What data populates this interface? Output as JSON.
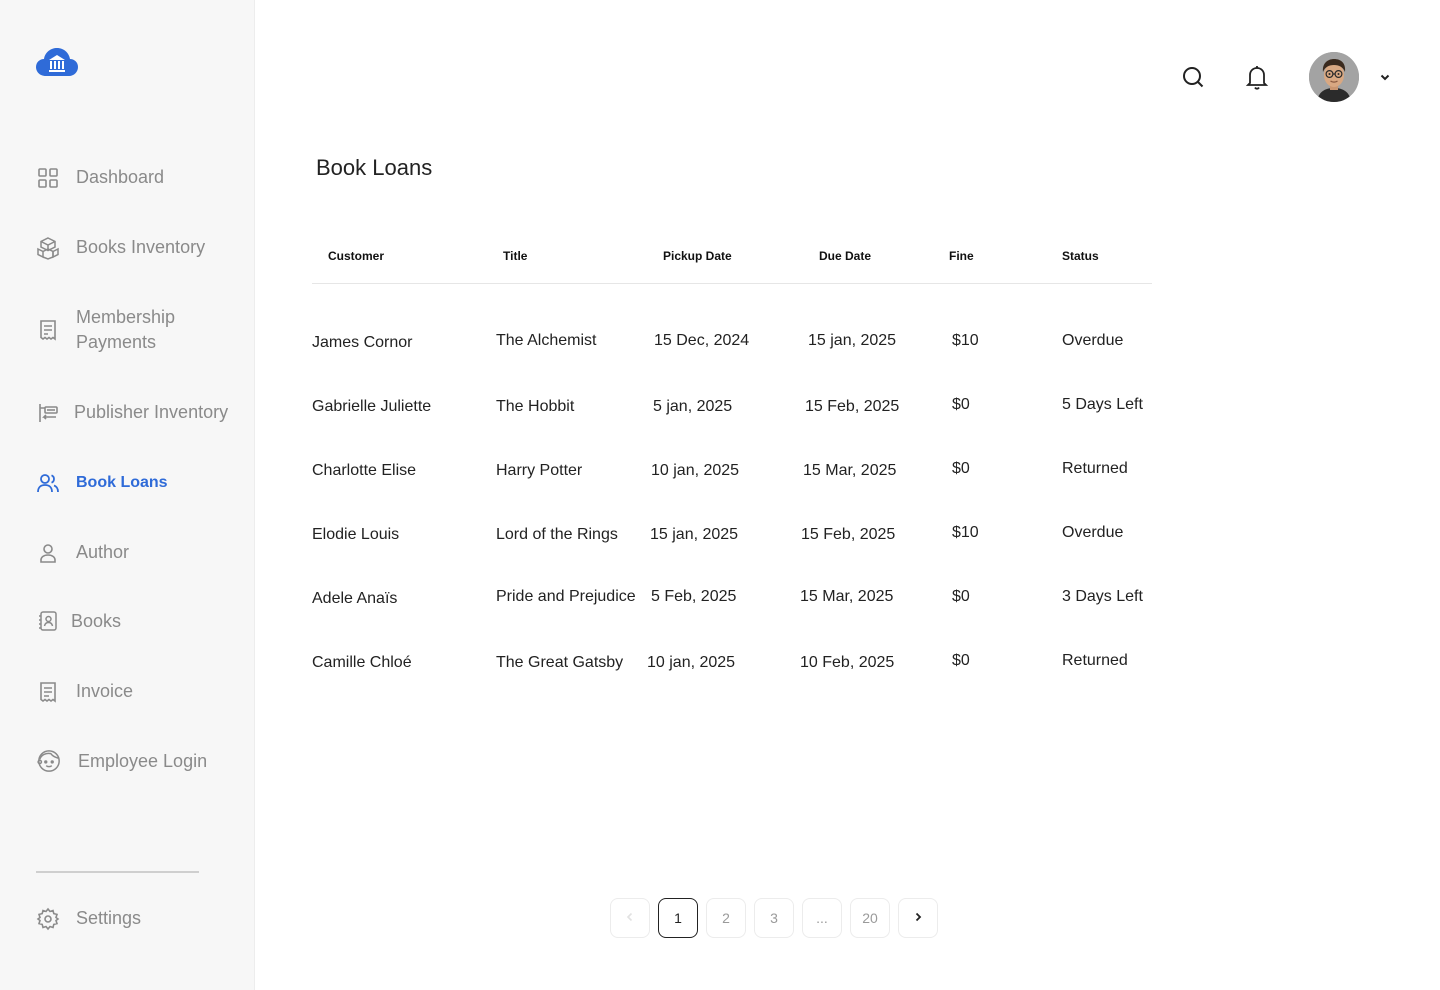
{
  "sidebar": {
    "items": [
      {
        "label": "Dashboard",
        "icon": "grid-icon"
      },
      {
        "label": "Books Inventory",
        "icon": "boxes-icon"
      },
      {
        "label": "Membership Payments",
        "icon": "receipt-icon"
      },
      {
        "label": "Publisher Inventory",
        "icon": "transfer-icon"
      },
      {
        "label": "Book Loans",
        "icon": "users-icon"
      },
      {
        "label": "Author",
        "icon": "user-icon"
      },
      {
        "label": "Books",
        "icon": "book-icon"
      },
      {
        "label": "Invoice",
        "icon": "invoice-icon"
      },
      {
        "label": "Employee Login",
        "icon": "face-icon"
      }
    ],
    "active_item": "Book Loans",
    "settings_label": "Settings"
  },
  "page": {
    "title": "Book Loans"
  },
  "table": {
    "columns": [
      "Customer",
      "Title",
      "Pickup Date",
      "Due Date",
      "Fine",
      "Status"
    ],
    "rows": [
      {
        "customer": "James Cornor",
        "title": "The Alchemist",
        "pickup": "15 Dec, 2024",
        "due": "15 jan, 2025",
        "fine": "$10",
        "status": "Overdue"
      },
      {
        "customer": "Gabrielle Juliette",
        "title": "The Hobbit",
        "pickup": "5 jan, 2025",
        "due": "15 Feb, 2025",
        "fine": "$0",
        "status": "5 Days Left"
      },
      {
        "customer": "Charlotte Elise",
        "title": "Harry Potter",
        "pickup": "10 jan, 2025",
        "due": "15 Mar, 2025",
        "fine": "$0",
        "status": "Returned"
      },
      {
        "customer": "Elodie Louis",
        "title": "Lord of the Rings",
        "pickup": "15 jan, 2025",
        "due": "15 Feb, 2025",
        "fine": "$10",
        "status": "Overdue"
      },
      {
        "customer": "Adele Anaïs",
        "title": "Pride and Prejudice",
        "pickup": "5 Feb, 2025",
        "due": "15 Mar, 2025",
        "fine": "$0",
        "status": "3 Days Left"
      },
      {
        "customer": "Camille Chloé",
        "title": "The Great Gatsby",
        "pickup": "10 jan, 2025",
        "due": "10 Feb, 2025",
        "fine": "$0",
        "status": "Returned"
      }
    ]
  },
  "pagination": {
    "pages": [
      "1",
      "2",
      "3",
      "...",
      "20"
    ],
    "current": "1"
  },
  "colors": {
    "accent": "#2f6bd8",
    "nav_text": "#8a8a8a",
    "sidebar_bg": "#f7f7f7"
  }
}
